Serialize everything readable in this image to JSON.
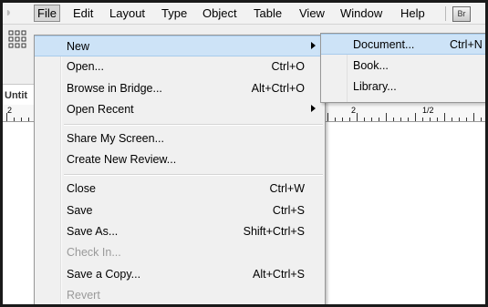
{
  "menubar": {
    "items": [
      "File",
      "Edit",
      "Layout",
      "Type",
      "Object",
      "Table",
      "View",
      "Window",
      "Help"
    ],
    "bridge_label": "Br"
  },
  "workspace": {
    "doc_tab": "Untit",
    "ruler_labels": [
      "2",
      "2",
      "1/2"
    ]
  },
  "file_menu": {
    "items": [
      {
        "label": "New",
        "shortcut": "",
        "submenu": true
      },
      {
        "label": "Open...",
        "shortcut": "Ctrl+O"
      },
      {
        "label": "Browse in Bridge...",
        "shortcut": "Alt+Ctrl+O"
      },
      {
        "label": "Open Recent",
        "shortcut": "",
        "submenu": true
      },
      {
        "label": "Share My Screen...",
        "shortcut": ""
      },
      {
        "label": "Create New Review...",
        "shortcut": ""
      },
      {
        "label": "Close",
        "shortcut": "Ctrl+W"
      },
      {
        "label": "Save",
        "shortcut": "Ctrl+S"
      },
      {
        "label": "Save As...",
        "shortcut": "Shift+Ctrl+S"
      },
      {
        "label": "Check In...",
        "shortcut": "",
        "disabled": true
      },
      {
        "label": "Save a Copy...",
        "shortcut": "Alt+Ctrl+S"
      },
      {
        "label": "Revert",
        "shortcut": "",
        "disabled": true
      }
    ]
  },
  "new_submenu": {
    "items": [
      {
        "label": "Document...",
        "shortcut": "Ctrl+N"
      },
      {
        "label": "Book...",
        "shortcut": ""
      },
      {
        "label": "Library...",
        "shortcut": ""
      }
    ]
  },
  "colors": {
    "highlight": "#cde3f7",
    "menu_bg": "#f0f0f0",
    "disabled_text": "#9a9a9a"
  }
}
